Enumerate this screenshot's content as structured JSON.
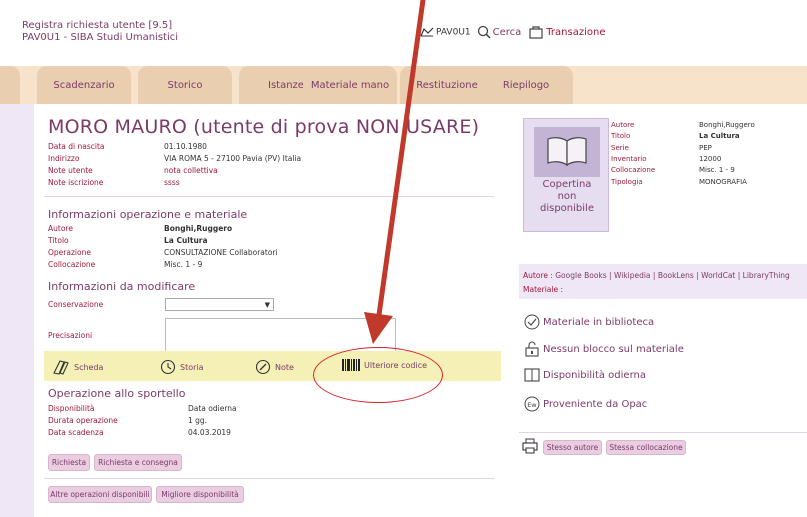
{
  "header": {
    "title_line1": "Registra richiesta utente [9.5]",
    "title_line2": "PAV0U1 - SIBA Studi Umanistici",
    "user": "PAV0U1",
    "search": "Cerca",
    "transaction": "Transazione"
  },
  "tabs": [
    "Scadenzario",
    "Storico",
    "Istanze",
    "Materiale mano",
    "Restituzione",
    "Riepilogo"
  ],
  "user_section": {
    "name": "MORO MAURO (utente di prova NON USARE)",
    "fields": [
      {
        "k": "Data di nascita",
        "v": "01.10.1980"
      },
      {
        "k": "Indirizzo",
        "v": "VIA ROMA 5 - 27100 Pavia (PV) Italia"
      },
      {
        "k": "Note utente",
        "v": "nota collettiva"
      },
      {
        "k": "Note iscrizione",
        "v": "ssss"
      }
    ]
  },
  "op_section": {
    "title": "Informazioni operazione e materiale",
    "fields": [
      {
        "k": "Autore",
        "v": "Bonghi,Ruggero"
      },
      {
        "k": "Titolo",
        "v": "La Cultura"
      },
      {
        "k": "Operazione",
        "v": "CONSULTAZIONE Collaboratori"
      },
      {
        "k": "Collocazione",
        "v": "Misc. 1 - 9"
      }
    ]
  },
  "modify_section": {
    "title": "Informazioni da modificare",
    "conservazione_label": "Conservazione",
    "precisazioni_label": "Precisazioni"
  },
  "toolbar": {
    "scheda": "Scheda",
    "storia": "Storia",
    "note": "Note",
    "ulteriore": "Ulteriore codice"
  },
  "sportello": {
    "title": "Operazione allo sportello",
    "fields": [
      {
        "k": "Disponibilità",
        "v": "Data odierna"
      },
      {
        "k": "Durata operazione",
        "v": "1 gg."
      },
      {
        "k": "Data scadenza",
        "v": "04.03.2019"
      }
    ]
  },
  "buttons": {
    "richiesta": "Richiesta",
    "richiesta_consegna": "Richiesta e consegna",
    "altre": "Altre operazioni disponibili",
    "migliore": "Migliore disponibilità"
  },
  "book": {
    "cover_line1": "Copertina",
    "cover_line2": "non",
    "cover_line3": "disponibile",
    "fields": [
      {
        "k": "Autore",
        "v": "Bonghi,Ruggero"
      },
      {
        "k": "Titolo",
        "v": "La Cultura"
      },
      {
        "k": "Serie",
        "v": "PEP"
      },
      {
        "k": "Inventario",
        "v": "12000"
      },
      {
        "k": "Collocazione",
        "v": "Misc. 1 - 9"
      },
      {
        "k": "Tipologia",
        "v": "MONOGRAFIA"
      }
    ]
  },
  "links": {
    "autore_label": "Autore :",
    "autore_links": "Google Books | Wikipedia | BookLens | WorldCat | LibraryThing",
    "materiale_label": "Materiale :"
  },
  "status": {
    "biblioteca": "Materiale in biblioteca",
    "blocco": "Nessun blocco sul materiale",
    "disponibilita": "Disponibilità odierna",
    "opac": "Proveniente da Opac"
  },
  "right_buttons": {
    "stesso_autore": "Stesso autore",
    "stessa_collocazione": "Stessa collocazione"
  },
  "colors": {
    "accent": "#7a3b69",
    "label": "#a0183a",
    "tab": "#e9ceb0",
    "toolbar": "#f5f0b6",
    "annotation": "#d9222a"
  }
}
